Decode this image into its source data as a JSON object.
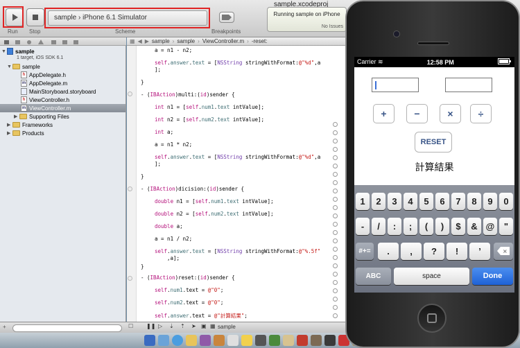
{
  "toolbar": {
    "run_label": "Run",
    "stop_label": "Stop",
    "scheme_label": "Scheme",
    "scheme_target": "sample",
    "scheme_separator": "›",
    "scheme_device": "iPhone 6.1 Simulator",
    "breakpoints_label": "Breakpoints",
    "window_title": "sample.xcodeproj",
    "activity_status": "Running sample on iPhone",
    "activity_issues": "No Issues"
  },
  "navigator": {
    "project_name": "sample",
    "project_subtitle": "1 target, iOS SDK 6.1",
    "items": [
      {
        "label": "sample",
        "kind": "folder"
      },
      {
        "label": "AppDelegate.h",
        "kind": "h"
      },
      {
        "label": "AppDelegate.m",
        "kind": "m"
      },
      {
        "label": "MainStoryboard.storyboard",
        "kind": "sb"
      },
      {
        "label": "ViewController.h",
        "kind": "h"
      },
      {
        "label": "ViewController.m",
        "kind": "m"
      },
      {
        "label": "Supporting Files",
        "kind": "folder"
      },
      {
        "label": "Frameworks",
        "kind": "folder"
      },
      {
        "label": "Products",
        "kind": "folder"
      }
    ]
  },
  "jump_bar": {
    "crumbs": [
      "sample",
      "sample",
      "ViewController.m",
      "-reset:"
    ]
  },
  "code": {
    "l1": "a = n1 - n2;",
    "l2a": "self",
    "l2b": ".",
    "l2c": "answer",
    "l2d": ".",
    "l2e": "text",
    "l2f": " = [",
    "l2g": "NSString",
    "l2h": " stringWithFormat:",
    "l2i": "@\"%d\"",
    "l2j": ",a",
    "l2k": "];",
    "close": "}",
    "m_multi_a": "- (",
    "m_multi_b": "IBAction",
    "m_multi_c": ")multi:(",
    "m_multi_d": "id",
    "m_multi_e": ")sender {",
    "int_kw": "int",
    "double_kw": "double",
    "n1_decl": " n1 = [",
    "n2_decl": " n2 = [",
    "self_kw": "self",
    "num1": "num1",
    "num2": "num2",
    "text_prop": "text",
    "intValue": " intValue];",
    "a_decl": " a;",
    "mul": "a = n1 * n2;",
    "div": "a = n1 / n2;",
    "m_div_c": ")dicision:(",
    "m_reset_c": ")reset:(",
    "fmt_f": "@\"%.5f\"",
    "fmt_f_cont": ",a];",
    "zero": "@\"0\"",
    "kekka": "@\"計算結果\"",
    "eq_assign": ".text = ",
    "semi": ";"
  },
  "bottom_bar": {
    "breadcrumb": "sample"
  },
  "simulator": {
    "carrier": "Carrier",
    "time": "12:58 PM",
    "ops": [
      "+",
      "−",
      "×",
      "÷"
    ],
    "reset_label": "RESET",
    "answer_label": "計算結果",
    "keyboard": {
      "row1": [
        "1",
        "2",
        "3",
        "4",
        "5",
        "6",
        "7",
        "8",
        "9",
        "0"
      ],
      "row2": [
        "-",
        "/",
        ":",
        ";",
        "(",
        ")",
        "$",
        "&",
        "@",
        "\""
      ],
      "row3_left": "#+=",
      "row3": [
        ".",
        ",",
        "?",
        "!",
        "’"
      ],
      "abc": "ABC",
      "space": "space",
      "done": "Done"
    }
  }
}
